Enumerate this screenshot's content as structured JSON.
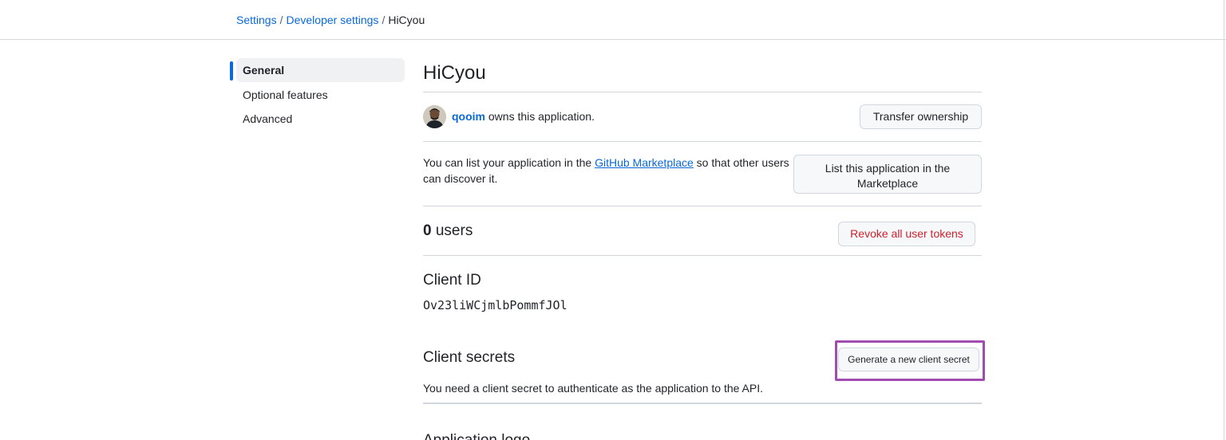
{
  "breadcrumb": {
    "settings": "Settings",
    "developer_settings": "Developer settings",
    "current": "HiCyou",
    "separator": "/"
  },
  "sidebar": {
    "items": [
      {
        "label": "General",
        "active": true
      },
      {
        "label": "Optional features",
        "active": false
      },
      {
        "label": "Advanced",
        "active": false
      }
    ]
  },
  "app": {
    "title": "HiCyou",
    "owner_name": "qooim",
    "owner_suffix": " owns this application.",
    "transfer_label": "Transfer ownership",
    "marketplace_text_before": "You can list your application in the ",
    "marketplace_link": "GitHub Marketplace",
    "marketplace_text_after": " so that other users can discover it.",
    "marketplace_button_line1": "List this application in the",
    "marketplace_button_line2": "Marketplace",
    "users_count": "0",
    "users_label": " users",
    "revoke_label": "Revoke all user tokens",
    "client_id_label": "Client ID",
    "client_id_value": "Ov23liWCjmlbPommfJOl",
    "client_secrets_label": "Client secrets",
    "generate_secret_label": "Generate a new client secret",
    "client_secrets_desc": "You need a client secret to authenticate as the application to the API.",
    "next_heading": "Application logo"
  },
  "colors": {
    "link": "#0969da",
    "danger": "#cf222e",
    "border": "#d0d7de",
    "highlight": "#a24bb0"
  }
}
